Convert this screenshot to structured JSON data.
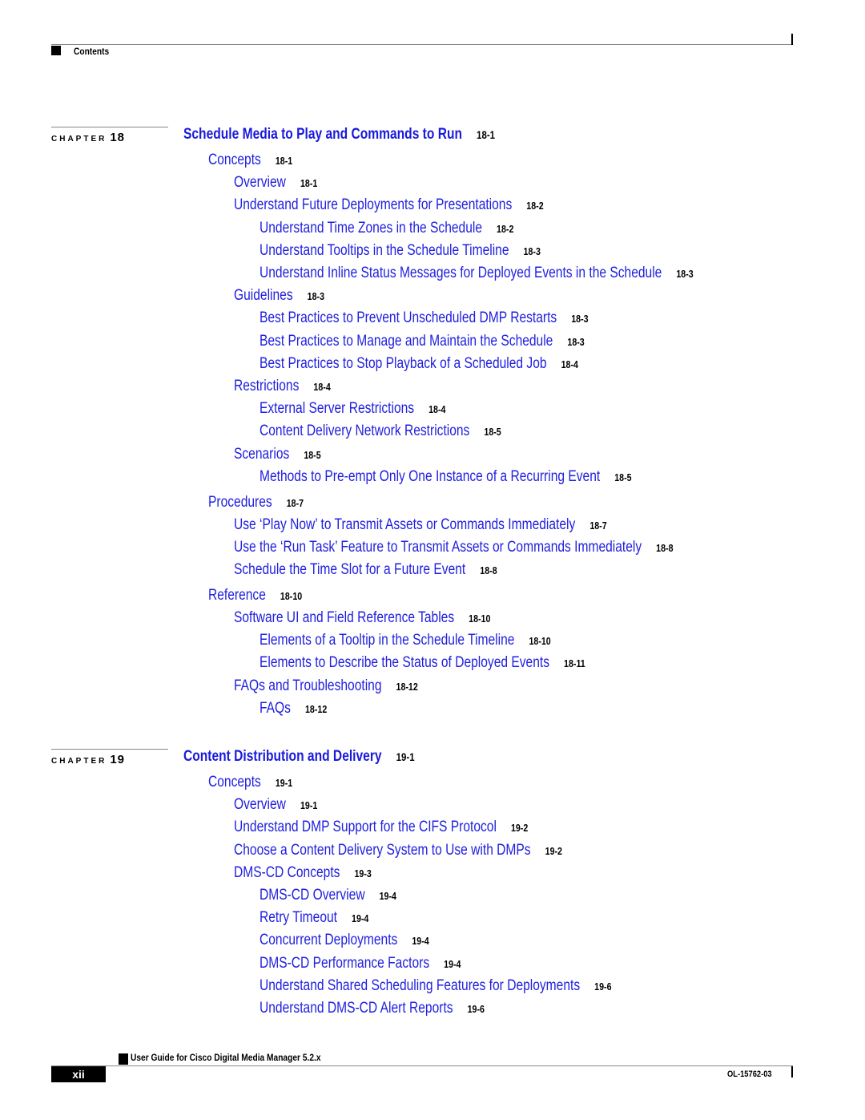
{
  "header": {
    "label": "Contents"
  },
  "chapters": [
    {
      "chapter_word": "CHAPTER",
      "number": "18",
      "title": "Schedule Media to Play and Commands to Run",
      "page": "18-1",
      "entries": [
        {
          "level": 1,
          "text": "Concepts",
          "page": "18-1"
        },
        {
          "level": 2,
          "text": "Overview",
          "page": "18-1"
        },
        {
          "level": 2,
          "text": "Understand Future Deployments for Presentations",
          "page": "18-2"
        },
        {
          "level": 3,
          "text": "Understand Time Zones in the Schedule",
          "page": "18-2"
        },
        {
          "level": 3,
          "text": "Understand Tooltips in the Schedule Timeline",
          "page": "18-3"
        },
        {
          "level": 3,
          "text": "Understand Inline Status Messages for Deployed Events in the Schedule",
          "page": "18-3"
        },
        {
          "level": 2,
          "text": "Guidelines",
          "page": "18-3"
        },
        {
          "level": 3,
          "text": "Best Practices to Prevent Unscheduled DMP Restarts",
          "page": "18-3"
        },
        {
          "level": 3,
          "text": "Best Practices to Manage and Maintain the Schedule",
          "page": "18-3"
        },
        {
          "level": 3,
          "text": "Best Practices to Stop Playback of a Scheduled Job",
          "page": "18-4"
        },
        {
          "level": 2,
          "text": "Restrictions",
          "page": "18-4"
        },
        {
          "level": 3,
          "text": "External Server Restrictions",
          "page": "18-4"
        },
        {
          "level": 3,
          "text": "Content Delivery Network Restrictions",
          "page": "18-5"
        },
        {
          "level": 2,
          "text": "Scenarios",
          "page": "18-5"
        },
        {
          "level": 3,
          "text": "Methods to Pre-empt Only One Instance of a Recurring Event",
          "page": "18-5"
        },
        {
          "level": 1,
          "text": "Procedures",
          "page": "18-7"
        },
        {
          "level": 2,
          "text": "Use ‘Play Now’ to Transmit Assets or Commands Immediately",
          "page": "18-7"
        },
        {
          "level": 2,
          "text": "Use the ‘Run Task’ Feature to Transmit Assets or Commands Immediately",
          "page": "18-8"
        },
        {
          "level": 2,
          "text": "Schedule the Time Slot for a Future Event",
          "page": "18-8"
        },
        {
          "level": 1,
          "text": "Reference",
          "page": "18-10"
        },
        {
          "level": 2,
          "text": "Software UI and Field Reference Tables",
          "page": "18-10"
        },
        {
          "level": 3,
          "text": "Elements of a Tooltip in the Schedule Timeline",
          "page": "18-10"
        },
        {
          "level": 3,
          "text": "Elements to Describe the Status of Deployed Events",
          "page": "18-11"
        },
        {
          "level": 2,
          "text": "FAQs and Troubleshooting",
          "page": "18-12"
        },
        {
          "level": 3,
          "text": "FAQs",
          "page": "18-12"
        }
      ]
    },
    {
      "chapter_word": "CHAPTER",
      "number": "19",
      "title": "Content Distribution and Delivery",
      "page": "19-1",
      "entries": [
        {
          "level": 1,
          "text": "Concepts",
          "page": "19-1"
        },
        {
          "level": 2,
          "text": "Overview",
          "page": "19-1"
        },
        {
          "level": 2,
          "text": "Understand DMP Support for the CIFS Protocol",
          "page": "19-2"
        },
        {
          "level": 2,
          "text": "Choose a Content Delivery System to Use with DMPs",
          "page": "19-2"
        },
        {
          "level": 2,
          "text": "DMS-CD Concepts",
          "page": "19-3"
        },
        {
          "level": 3,
          "text": "DMS-CD Overview",
          "page": "19-4"
        },
        {
          "level": 3,
          "text": "Retry Timeout",
          "page": "19-4"
        },
        {
          "level": 3,
          "text": "Concurrent Deployments",
          "page": "19-4"
        },
        {
          "level": 3,
          "text": "DMS-CD Performance Factors",
          "page": "19-4"
        },
        {
          "level": 3,
          "text": "Understand Shared Scheduling Features for Deployments",
          "page": "19-6"
        },
        {
          "level": 3,
          "text": "Understand DMS-CD Alert Reports",
          "page": "19-6"
        }
      ]
    }
  ],
  "footer": {
    "guide_title": "User Guide for Cisco Digital Media Manager 5.2.x",
    "page_number": "xii",
    "doc_number": "OL-15762-03"
  }
}
